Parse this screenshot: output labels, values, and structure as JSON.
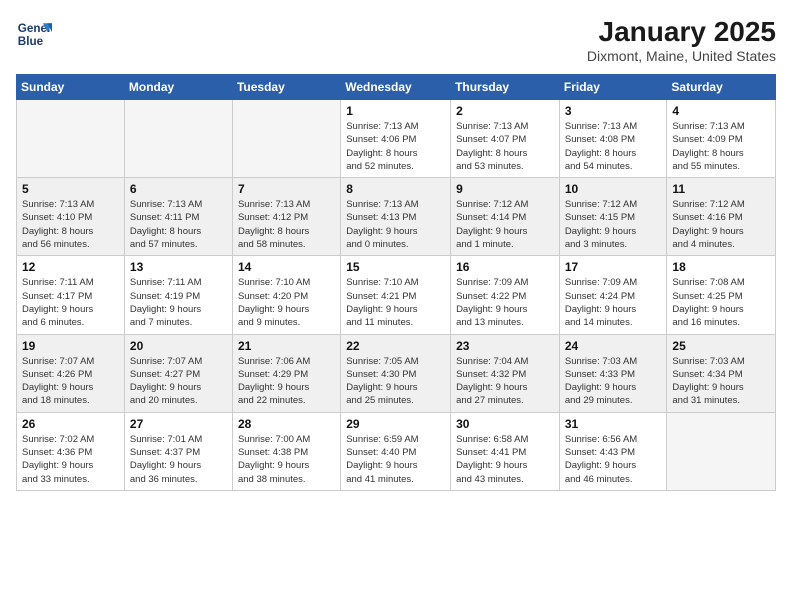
{
  "logo": {
    "line1": "General",
    "line2": "Blue"
  },
  "title": "January 2025",
  "subtitle": "Dixmont, Maine, United States",
  "weekdays": [
    "Sunday",
    "Monday",
    "Tuesday",
    "Wednesday",
    "Thursday",
    "Friday",
    "Saturday"
  ],
  "weeks": [
    [
      {
        "day": "",
        "info": ""
      },
      {
        "day": "",
        "info": ""
      },
      {
        "day": "",
        "info": ""
      },
      {
        "day": "1",
        "info": "Sunrise: 7:13 AM\nSunset: 4:06 PM\nDaylight: 8 hours\nand 52 minutes."
      },
      {
        "day": "2",
        "info": "Sunrise: 7:13 AM\nSunset: 4:07 PM\nDaylight: 8 hours\nand 53 minutes."
      },
      {
        "day": "3",
        "info": "Sunrise: 7:13 AM\nSunset: 4:08 PM\nDaylight: 8 hours\nand 54 minutes."
      },
      {
        "day": "4",
        "info": "Sunrise: 7:13 AM\nSunset: 4:09 PM\nDaylight: 8 hours\nand 55 minutes."
      }
    ],
    [
      {
        "day": "5",
        "info": "Sunrise: 7:13 AM\nSunset: 4:10 PM\nDaylight: 8 hours\nand 56 minutes."
      },
      {
        "day": "6",
        "info": "Sunrise: 7:13 AM\nSunset: 4:11 PM\nDaylight: 8 hours\nand 57 minutes."
      },
      {
        "day": "7",
        "info": "Sunrise: 7:13 AM\nSunset: 4:12 PM\nDaylight: 8 hours\nand 58 minutes."
      },
      {
        "day": "8",
        "info": "Sunrise: 7:13 AM\nSunset: 4:13 PM\nDaylight: 9 hours\nand 0 minutes."
      },
      {
        "day": "9",
        "info": "Sunrise: 7:12 AM\nSunset: 4:14 PM\nDaylight: 9 hours\nand 1 minute."
      },
      {
        "day": "10",
        "info": "Sunrise: 7:12 AM\nSunset: 4:15 PM\nDaylight: 9 hours\nand 3 minutes."
      },
      {
        "day": "11",
        "info": "Sunrise: 7:12 AM\nSunset: 4:16 PM\nDaylight: 9 hours\nand 4 minutes."
      }
    ],
    [
      {
        "day": "12",
        "info": "Sunrise: 7:11 AM\nSunset: 4:17 PM\nDaylight: 9 hours\nand 6 minutes."
      },
      {
        "day": "13",
        "info": "Sunrise: 7:11 AM\nSunset: 4:19 PM\nDaylight: 9 hours\nand 7 minutes."
      },
      {
        "day": "14",
        "info": "Sunrise: 7:10 AM\nSunset: 4:20 PM\nDaylight: 9 hours\nand 9 minutes."
      },
      {
        "day": "15",
        "info": "Sunrise: 7:10 AM\nSunset: 4:21 PM\nDaylight: 9 hours\nand 11 minutes."
      },
      {
        "day": "16",
        "info": "Sunrise: 7:09 AM\nSunset: 4:22 PM\nDaylight: 9 hours\nand 13 minutes."
      },
      {
        "day": "17",
        "info": "Sunrise: 7:09 AM\nSunset: 4:24 PM\nDaylight: 9 hours\nand 14 minutes."
      },
      {
        "day": "18",
        "info": "Sunrise: 7:08 AM\nSunset: 4:25 PM\nDaylight: 9 hours\nand 16 minutes."
      }
    ],
    [
      {
        "day": "19",
        "info": "Sunrise: 7:07 AM\nSunset: 4:26 PM\nDaylight: 9 hours\nand 18 minutes."
      },
      {
        "day": "20",
        "info": "Sunrise: 7:07 AM\nSunset: 4:27 PM\nDaylight: 9 hours\nand 20 minutes."
      },
      {
        "day": "21",
        "info": "Sunrise: 7:06 AM\nSunset: 4:29 PM\nDaylight: 9 hours\nand 22 minutes."
      },
      {
        "day": "22",
        "info": "Sunrise: 7:05 AM\nSunset: 4:30 PM\nDaylight: 9 hours\nand 25 minutes."
      },
      {
        "day": "23",
        "info": "Sunrise: 7:04 AM\nSunset: 4:32 PM\nDaylight: 9 hours\nand 27 minutes."
      },
      {
        "day": "24",
        "info": "Sunrise: 7:03 AM\nSunset: 4:33 PM\nDaylight: 9 hours\nand 29 minutes."
      },
      {
        "day": "25",
        "info": "Sunrise: 7:03 AM\nSunset: 4:34 PM\nDaylight: 9 hours\nand 31 minutes."
      }
    ],
    [
      {
        "day": "26",
        "info": "Sunrise: 7:02 AM\nSunset: 4:36 PM\nDaylight: 9 hours\nand 33 minutes."
      },
      {
        "day": "27",
        "info": "Sunrise: 7:01 AM\nSunset: 4:37 PM\nDaylight: 9 hours\nand 36 minutes."
      },
      {
        "day": "28",
        "info": "Sunrise: 7:00 AM\nSunset: 4:38 PM\nDaylight: 9 hours\nand 38 minutes."
      },
      {
        "day": "29",
        "info": "Sunrise: 6:59 AM\nSunset: 4:40 PM\nDaylight: 9 hours\nand 41 minutes."
      },
      {
        "day": "30",
        "info": "Sunrise: 6:58 AM\nSunset: 4:41 PM\nDaylight: 9 hours\nand 43 minutes."
      },
      {
        "day": "31",
        "info": "Sunrise: 6:56 AM\nSunset: 4:43 PM\nDaylight: 9 hours\nand 46 minutes."
      },
      {
        "day": "",
        "info": ""
      }
    ]
  ]
}
